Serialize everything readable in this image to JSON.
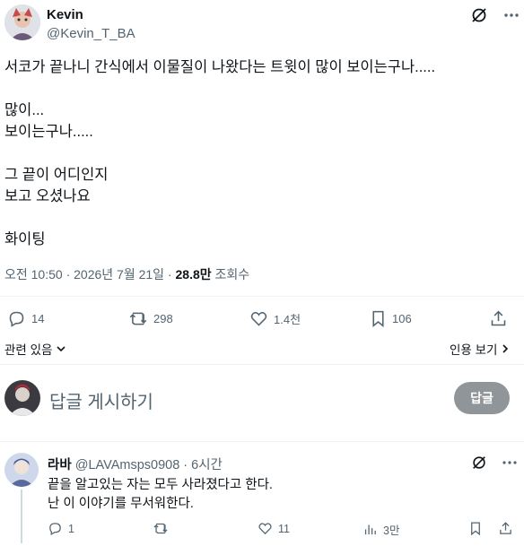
{
  "tweet": {
    "author_name": "Kevin",
    "author_handle": "@Kevin_T_BA",
    "text": "서코가 끝나니 간식에서 이물질이 나왔다는 트윗이 많이 보이는구나.....\n\n많이...\n보이는구나.....\n\n그 끝이 어디인지\n보고 오셨나요\n\n화이팅",
    "meta_time": "오전 10:50 · 2026년 7월 21일 · ",
    "meta_views_count": "28.8만",
    "meta_views_label": "조회수",
    "actions": {
      "replies": "14",
      "retweets": "298",
      "likes": "1.4천",
      "bookmarks": "106"
    },
    "related_label": "관련 있음",
    "quotes_label": "인용 보기"
  },
  "reply_box": {
    "placeholder": "답글 게시하기",
    "button_label": "답글"
  },
  "reply": {
    "author_name": "라바",
    "author_handle": "@LAVAmsps0908",
    "time": "· 6시간",
    "line1": "끝을 알고있는 자는 모두 사라졌다고 한다.",
    "line2": "난 이 이야기를 무서워한다.",
    "actions": {
      "replies": "1",
      "likes": "11",
      "views": "3만"
    }
  },
  "icons": [
    "grok-icon",
    "reply-icon",
    "retweet-icon",
    "like-icon",
    "bookmark-icon",
    "share-icon",
    "views-icon",
    "chevron-down-icon",
    "chevron-right-icon"
  ]
}
